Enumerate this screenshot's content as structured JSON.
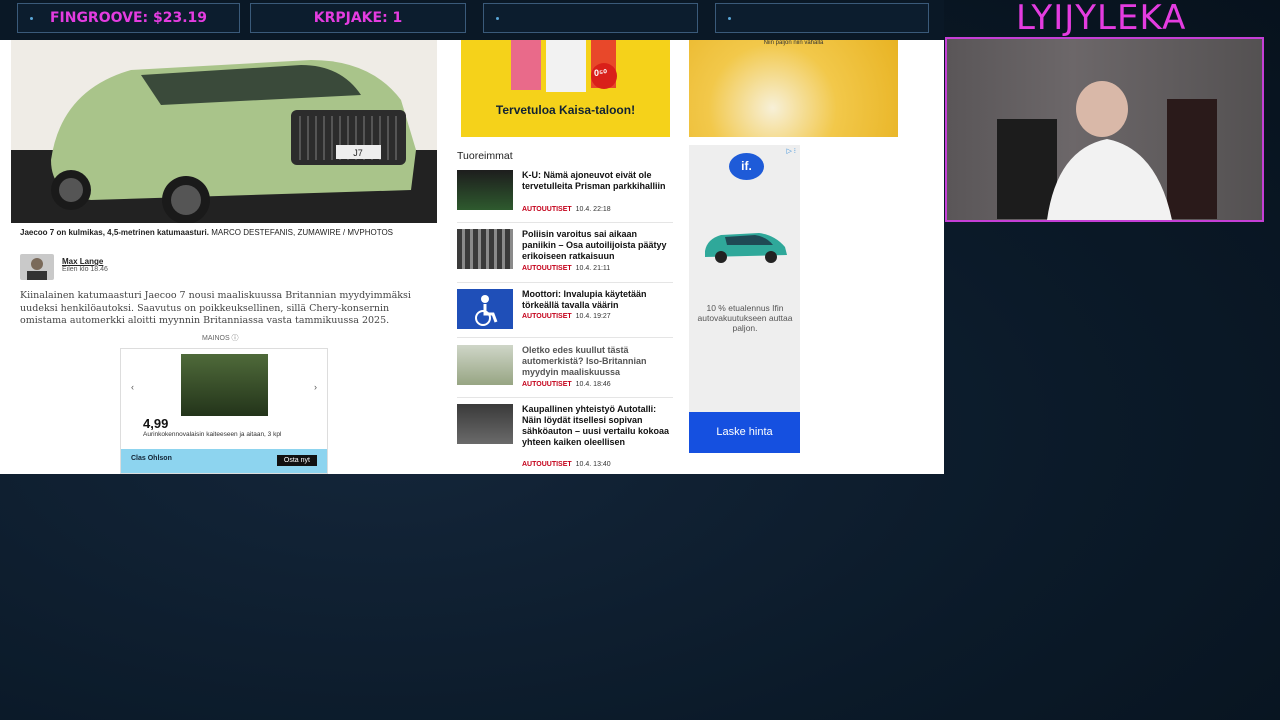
{
  "overlay": {
    "stats": [
      "FINGROOVE: $23.19",
      "KRPJAKE: 1",
      "",
      ""
    ],
    "streamer": "LYIJYLEKA"
  },
  "article": {
    "caption_bold": "Jaecoo 7 on kulmikas, 4,5-metrinen katumaasturi.",
    "caption_credit": "MARCO DESTEFANIS, ZUMAWIRE / MVPHOTOS",
    "author": "Max Lange",
    "time": "Eilen klo 18.46",
    "body": "Kiinalainen katumaasturi Jaecoo 7 nousi maaliskuussa Britannian myydyimmäksi uudeksi henkilöautoksi. Saavutus on poikkeuksellinen, sillä Chery-konsernin omistama automerkki aloitti myynnin Britanniassa vasta tammikuussa 2025.",
    "ad_label": "MAINOS ⓘ",
    "car_plate": "J7"
  },
  "clas_ad": {
    "price": "4,99",
    "desc": "Aurinkokennovalaisin kaiteeseen ja aitaan, 3 kpl",
    "brand": "Clas Ohlson",
    "cta": "Osta nyt"
  },
  "ads": {
    "kaisa": "Tervetuloa Kaisa-taloon!",
    "kaisa_price": "0⁵⁰",
    "yellow2": "Niin paljon niin vähällä"
  },
  "news": {
    "section": "Tuoreimmat",
    "items": [
      {
        "title": "K-U: Nämä ajoneuvot eivät ole tervetulleita Prisman parkkihalliin",
        "cat": "AUTOUUTISET",
        "time": "10.4. 22:18"
      },
      {
        "title": "Poliisin varoitus sai aikaan paniikin – Osa autoilijoista päätyy erikoiseen ratkaisuun",
        "cat": "AUTOUUTISET",
        "time": "10.4. 21:11"
      },
      {
        "title": "Moottori: Invalupia käytetään törkeällä tavalla väärin",
        "cat": "AUTOUUTISET",
        "time": "10.4. 19:27"
      },
      {
        "title": "Oletko edes kuullut tästä automerkistä? Iso-Britannian myydyin maaliskuussa",
        "cat": "AUTOUUTISET",
        "time": "10.4. 18:46"
      },
      {
        "title": "Kaupallinen yhteistyö Autotalli: Näin löydät itsellesi sopivan sähköauton – uusi vertailu kokoaa yhteen kaiken oleellisen",
        "cat": "AUTOUUTISET",
        "time": "10.4. 13:40"
      }
    ]
  },
  "if_ad": {
    "logo": "if.",
    "text": "10 % etualennus Ifin autovakuutukseen auttaa paljon.",
    "cta": "Laske hinta"
  }
}
